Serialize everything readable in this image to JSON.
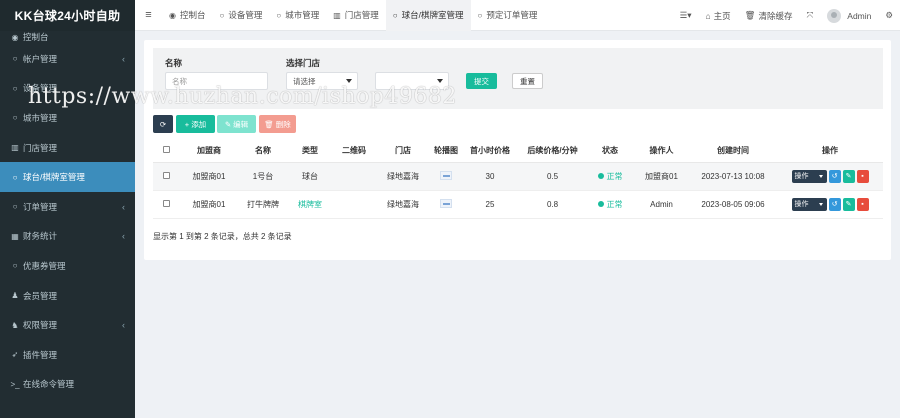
{
  "app": {
    "brand": "KK台球24小时自助"
  },
  "sidebar": {
    "items": [
      {
        "label": "控制台",
        "icon": "dashboard-icon",
        "glyph": "◉",
        "has_children": false,
        "active": false
      },
      {
        "label": "帐户管理",
        "icon": "circle-icon",
        "glyph": "○",
        "has_children": true,
        "active": false
      },
      {
        "label": "设备管理",
        "icon": "circle-icon",
        "glyph": "○",
        "has_children": false,
        "active": false
      },
      {
        "label": "城市管理",
        "icon": "circle-icon",
        "glyph": "○",
        "has_children": false,
        "active": false
      },
      {
        "label": "门店管理",
        "icon": "bank-icon",
        "glyph": "▥",
        "has_children": false,
        "active": false
      },
      {
        "label": "球台/棋牌室管理",
        "icon": "circle-icon",
        "glyph": "○",
        "has_children": false,
        "active": true
      },
      {
        "label": "订单管理",
        "icon": "circle-icon",
        "glyph": "○",
        "has_children": true,
        "active": false
      },
      {
        "label": "财务统计",
        "icon": "bar-chart-icon",
        "glyph": "▦",
        "has_children": true,
        "active": false
      },
      {
        "label": "优惠券管理",
        "icon": "circle-icon",
        "glyph": "○",
        "has_children": false,
        "active": false
      },
      {
        "label": "会员管理",
        "icon": "user-icon",
        "glyph": "♟",
        "has_children": false,
        "active": false
      },
      {
        "label": "权限管理",
        "icon": "users-icon",
        "glyph": "♞",
        "has_children": true,
        "active": false
      },
      {
        "label": "插件管理",
        "icon": "rocket-icon",
        "glyph": "➶",
        "has_children": false,
        "active": false
      },
      {
        "label": "在线命令管理",
        "icon": "terminal-icon",
        "glyph": ">_",
        "has_children": false,
        "active": false
      }
    ]
  },
  "header": {
    "tabs": [
      {
        "label": "控制台",
        "glyph": "◉",
        "icon": "dashboard-icon",
        "active": false
      },
      {
        "label": "设备管理",
        "glyph": "○",
        "icon": "circle-icon",
        "active": false
      },
      {
        "label": "城市管理",
        "glyph": "○",
        "icon": "circle-icon",
        "active": false
      },
      {
        "label": "门店管理",
        "glyph": "▥",
        "icon": "bank-icon",
        "active": false
      },
      {
        "label": "球台/棋牌室管理",
        "glyph": "○",
        "icon": "circle-icon",
        "active": true
      },
      {
        "label": "预定订单管理",
        "glyph": "○",
        "icon": "circle-icon",
        "active": false
      }
    ],
    "home_label": "主页",
    "clear_cache_label": "清除缓存",
    "user_name": "Admin"
  },
  "search": {
    "name_label": "名称",
    "name_placeholder": "名称",
    "store_label": "选择门店",
    "store_select_value": "请选择",
    "second_select_value": "",
    "submit_label": "提交",
    "reset_label": "重置"
  },
  "toolbar": {
    "add_label": "添加",
    "edit_label": "编辑",
    "delete_label": "删除"
  },
  "table": {
    "columns": [
      "加盟商",
      "名称",
      "类型",
      "二维码",
      "门店",
      "轮播图",
      "首小时价格",
      "后续价格/分钟",
      "状态",
      "操作人",
      "创建时间",
      "操作"
    ],
    "rows": [
      {
        "franchisee": "加盟商01",
        "name": "1号台",
        "type": "球台",
        "qrcode": "",
        "store": "绿地嘉海",
        "price_first_hour": "30",
        "price_per_min": "0.5",
        "status": "正常",
        "operator": "加盟商01",
        "created": "2023-07-13 10:08",
        "op_label": "操作"
      },
      {
        "franchisee": "加盟商01",
        "name": "打牛牌牌",
        "type": "棋牌室",
        "qrcode": "",
        "store": "绿地嘉海",
        "price_first_hour": "25",
        "price_per_min": "0.8",
        "status": "正常",
        "operator": "Admin",
        "created": "2023-08-05 09:06",
        "op_label": "操作"
      }
    ],
    "summary": "显示第 1 到第 2 条记录，总共 2 条记录"
  },
  "watermark": "https://www.huzhan.com/ishop49682",
  "colors": {
    "sidebar_bg": "#222d32",
    "active_blue": "#3c8dbc",
    "success_green": "#18bc9c",
    "danger_red": "#e74c3c",
    "dark_navy": "#2c3e50"
  }
}
